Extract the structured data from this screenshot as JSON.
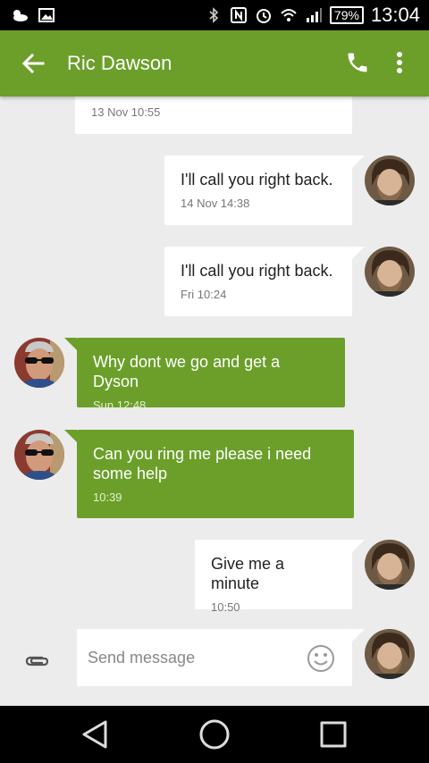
{
  "status_bar": {
    "battery": "79%",
    "time": "13:04"
  },
  "app_bar": {
    "contact_name": "Ric Dawson"
  },
  "messages": [
    {
      "id": "m0",
      "direction": "out",
      "text": "",
      "timestamp": "13 Nov 10:55"
    },
    {
      "id": "m1",
      "direction": "out",
      "text": "I'll call you right back.",
      "timestamp": "14 Nov 14:38"
    },
    {
      "id": "m2",
      "direction": "out",
      "text": "I'll call you right back.",
      "timestamp": "Fri 10:24"
    },
    {
      "id": "m3",
      "direction": "in",
      "text": "Why dont we go and get a Dyson",
      "timestamp": "Sun 12:48"
    },
    {
      "id": "m4",
      "direction": "in",
      "text": "Can you ring me please i need some help",
      "timestamp": "10:39"
    },
    {
      "id": "m5",
      "direction": "out",
      "text": "Give me a minute",
      "timestamp": "10:50"
    }
  ],
  "compose": {
    "placeholder": "Send message"
  },
  "colors": {
    "accent": "#6b9f2a",
    "background": "#ececec"
  },
  "icons": {
    "back": "arrow-back-icon",
    "call": "phone-icon",
    "more": "more-vert-icon",
    "attach": "paperclip-icon",
    "emoji": "smiley-icon"
  }
}
